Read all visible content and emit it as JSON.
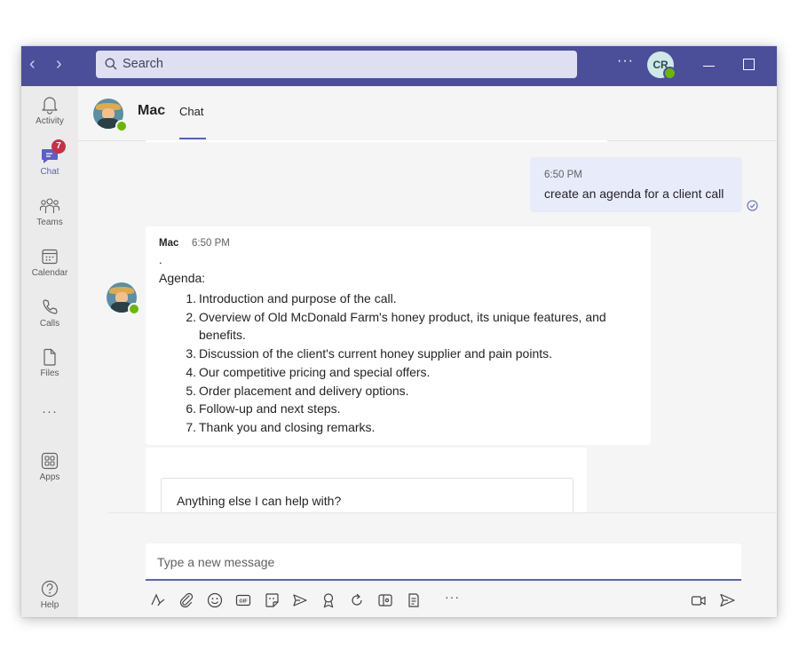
{
  "titlebar": {
    "search_placeholder": "Search",
    "more_label": "···",
    "user_initials": "CR"
  },
  "rail": {
    "items": [
      {
        "label": "Activity",
        "icon": "bell-icon"
      },
      {
        "label": "Chat",
        "icon": "chat-icon",
        "badge": "7"
      },
      {
        "label": "Teams",
        "icon": "teams-icon"
      },
      {
        "label": "Calendar",
        "icon": "calendar-icon"
      },
      {
        "label": "Calls",
        "icon": "phone-icon"
      },
      {
        "label": "Files",
        "icon": "file-icon"
      },
      {
        "label": "···",
        "icon": "more-icon"
      },
      {
        "label": "Apps",
        "icon": "apps-icon"
      },
      {
        "label": "Help",
        "icon": "help-icon"
      }
    ]
  },
  "header": {
    "name": "Mac",
    "tab": "Chat"
  },
  "messages": {
    "mine": {
      "time": "6:50 PM",
      "text": "create an agenda for a client call"
    },
    "bot": {
      "sender": "Mac",
      "time": "6:50 PM",
      "dot": ".",
      "agenda_title": "Agenda:",
      "items": [
        {
          "n": "1.",
          "text": "Introduction and purpose of the call."
        },
        {
          "n": "2.",
          "text": "Overview of Old McDonald Farm's honey product, its unique features, and benefits."
        },
        {
          "n": "3.",
          "text": "Discussion of the client's current honey supplier and pain points."
        },
        {
          "n": "4.",
          "text": "Our competitive pricing and special offers."
        },
        {
          "n": "5.",
          "text": "Order placement and delivery options."
        },
        {
          "n": "6.",
          "text": "Follow-up and next steps."
        },
        {
          "n": "7.",
          "text": "Thank you and closing remarks."
        }
      ]
    },
    "card_text": "Anything else I can help with?"
  },
  "compose": {
    "placeholder": "Type a new message",
    "more_label": "···"
  },
  "colors": {
    "brand": "#4b4f9a",
    "accent": "#5b5fc7",
    "badge": "#c4314b",
    "presence": "#6bb700",
    "my_bubble": "#e8ebfa"
  }
}
